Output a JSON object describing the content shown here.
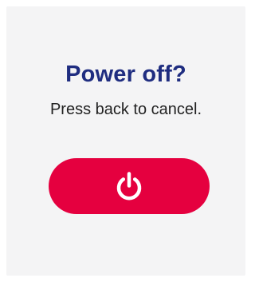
{
  "dialog": {
    "title": "Power off?",
    "subtitle": "Press back to cancel.",
    "action_icon": "power-icon"
  },
  "colors": {
    "title": "#1f2d80",
    "subtitle": "#222222",
    "card_background": "#f4f4f5",
    "button_background": "#e5003f",
    "icon": "#ffffff"
  }
}
